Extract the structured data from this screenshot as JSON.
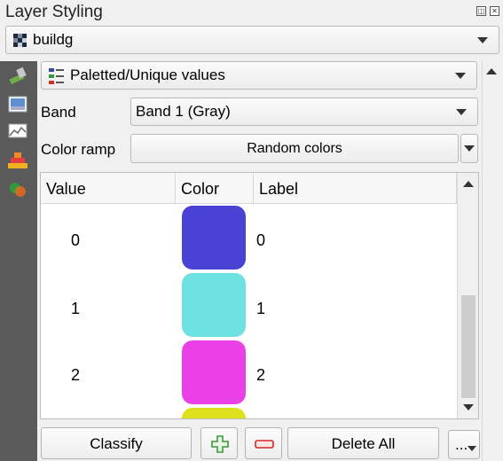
{
  "panel": {
    "title": "Layer Styling"
  },
  "layer_select": {
    "value": "buildg"
  },
  "renderer_select": {
    "value": "Paletted/Unique values"
  },
  "band": {
    "label": "Band",
    "value": "Band 1 (Gray)"
  },
  "color_ramp": {
    "label": "Color ramp",
    "value": "Random colors"
  },
  "table": {
    "columns": [
      "Value",
      "Color",
      "Label"
    ],
    "rows": [
      {
        "value": "0",
        "color": "#4a42d2",
        "label": "0"
      },
      {
        "value": "1",
        "color": "#6ee2e1",
        "label": "1"
      },
      {
        "value": "2",
        "color": "#ea40e8",
        "label": "2"
      },
      {
        "value": "",
        "color": "#dde01a",
        "label": ""
      }
    ]
  },
  "buttons": {
    "classify": "Classify",
    "delete_all": "Delete All",
    "more": "..."
  },
  "icons": {
    "add": "plus-icon",
    "remove": "minus-icon",
    "paint": "paintbrush-icon",
    "raster": "raster-icon",
    "histogram": "histogram-icon",
    "pyramid": "pyramid-icon",
    "render": "transparency-icon"
  },
  "colors": {
    "add": "#3a9a3a",
    "remove": "#d22828"
  }
}
